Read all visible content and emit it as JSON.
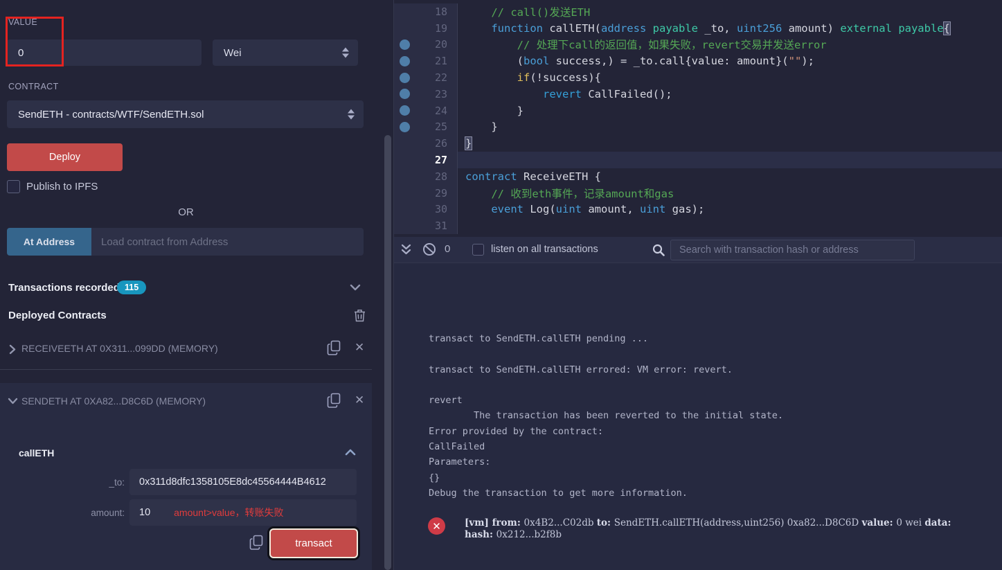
{
  "colors": {
    "base_bg": "#232437",
    "terminal_bg": "#262940",
    "danger_red": "#c24a49",
    "at_address_blue": "#35658c",
    "badge_teal": "#1896be",
    "annotation_red": "#e42320",
    "warning_red": "#e23c3c",
    "breakpoint_dot_blue": "#4f7ea8"
  },
  "left_panel": {
    "value_label": "VALUE",
    "value_input": "0",
    "unit_select": "Wei",
    "contract_label": "CONTRACT",
    "contract_select": "SendETH - contracts/WTF/SendETH.sol",
    "deploy_button": "Deploy",
    "publish_label": "Publish to IPFS",
    "or_divider": "OR",
    "at_address_button": "At Address",
    "at_address_placeholder": "Load contract from Address",
    "transactions_recorded_label": "Transactions recorded",
    "transactions_count": "115",
    "deployed_contracts_label": "Deployed Contracts",
    "contracts": [
      {
        "name": "RECEIVEETH AT 0X311...099DD (MEMORY)"
      },
      {
        "name": "SENDETH AT 0XA82...D8C6D (MEMORY)"
      }
    ],
    "function_panel": {
      "name": "callETH",
      "to_label": "_to:",
      "to_value": "0x311d8dfc1358105E8dc45564444B4612",
      "amount_label": "amount:",
      "amount_value": "10",
      "amount_warning": "amount>value，转账失败",
      "transact_button": "transact"
    }
  },
  "editor": {
    "lines": [
      {
        "n": "18",
        "dot": false,
        "active": false,
        "segs": [
          [
            "    ",
            ""
          ],
          [
            "// call()发送ETH",
            "com"
          ]
        ]
      },
      {
        "n": "19",
        "dot": false,
        "active": false,
        "segs": [
          [
            "    ",
            ""
          ],
          [
            "function",
            "kw"
          ],
          [
            " callETH(",
            ""
          ],
          [
            "address",
            "kw"
          ],
          [
            " ",
            ""
          ],
          [
            "payable",
            "type"
          ],
          [
            " _to, ",
            ""
          ],
          [
            "uint256",
            "kw"
          ],
          [
            " amount) ",
            ""
          ],
          [
            "external",
            "type"
          ],
          [
            " ",
            ""
          ],
          [
            "payable",
            "type"
          ],
          [
            "{",
            "br"
          ]
        ]
      },
      {
        "n": "20",
        "dot": true,
        "active": false,
        "segs": [
          [
            "        ",
            ""
          ],
          [
            "// 处理下call的返回值，如果失败，revert交易并发送error",
            "com"
          ]
        ]
      },
      {
        "n": "21",
        "dot": true,
        "active": false,
        "segs": [
          [
            "        (",
            ""
          ],
          [
            "bool",
            "kw"
          ],
          [
            " success,) = _to.call{value: amount}(",
            ""
          ],
          [
            "\"\"",
            "str"
          ],
          [
            ");",
            ""
          ]
        ]
      },
      {
        "n": "22",
        "dot": true,
        "active": false,
        "segs": [
          [
            "        ",
            ""
          ],
          [
            "if",
            "ctrl"
          ],
          [
            "(!success){",
            ""
          ]
        ]
      },
      {
        "n": "23",
        "dot": true,
        "active": false,
        "segs": [
          [
            "            ",
            ""
          ],
          [
            "revert",
            "rev"
          ],
          [
            " CallFailed();",
            ""
          ]
        ]
      },
      {
        "n": "24",
        "dot": true,
        "active": false,
        "segs": [
          [
            "        }",
            ""
          ]
        ]
      },
      {
        "n": "25",
        "dot": true,
        "active": false,
        "segs": [
          [
            "    }",
            ""
          ]
        ]
      },
      {
        "n": "26",
        "dot": false,
        "active": false,
        "segs": [
          [
            "}",
            "br"
          ]
        ]
      },
      {
        "n": "27",
        "dot": false,
        "active": true,
        "segs": []
      },
      {
        "n": "28",
        "dot": false,
        "active": false,
        "segs": [
          [
            "contract",
            "kw"
          ],
          [
            " ReceiveETH {",
            ""
          ]
        ]
      },
      {
        "n": "29",
        "dot": false,
        "active": false,
        "segs": [
          [
            "    ",
            ""
          ],
          [
            "// 收到eth事件，记录amount和gas",
            "com"
          ]
        ]
      },
      {
        "n": "30",
        "dot": false,
        "active": false,
        "segs": [
          [
            "    ",
            ""
          ],
          [
            "event",
            "kw"
          ],
          [
            " Log(",
            ""
          ],
          [
            "uint",
            "kw"
          ],
          [
            " amount, ",
            ""
          ],
          [
            "uint",
            "kw"
          ],
          [
            " gas);",
            ""
          ]
        ]
      },
      {
        "n": "31",
        "dot": false,
        "active": false,
        "segs": []
      }
    ]
  },
  "terminal": {
    "toolbar": {
      "pending_count": "0",
      "listen_label": "listen on all transactions",
      "search_placeholder": "Search with transaction hash or address"
    },
    "log_lines": [
      "transact to SendETH.callETH pending ...",
      "",
      "transact to SendETH.callETH errored: VM error: revert.",
      "",
      "revert",
      "        The transaction has been reverted to the initial state.",
      "Error provided by the contract:",
      "CallFailed",
      "Parameters:",
      "{}",
      "Debug the transaction to get more information."
    ],
    "error_entry": {
      "icon": "x-circle",
      "lines": [
        [
          [
            "[vm] ",
            true
          ],
          [
            "from: ",
            true
          ],
          [
            "0x4B2...C02db ",
            false
          ],
          [
            "to: ",
            true
          ],
          [
            "SendETH.callETH(address,uint256) 0xa82...D8C6D ",
            false
          ],
          [
            "value: ",
            true
          ],
          [
            "0 wei ",
            false
          ],
          [
            "data: ",
            true
          ]
        ],
        [
          [
            "hash: ",
            true
          ],
          [
            "0x212...b2f8b",
            false
          ]
        ]
      ]
    }
  }
}
